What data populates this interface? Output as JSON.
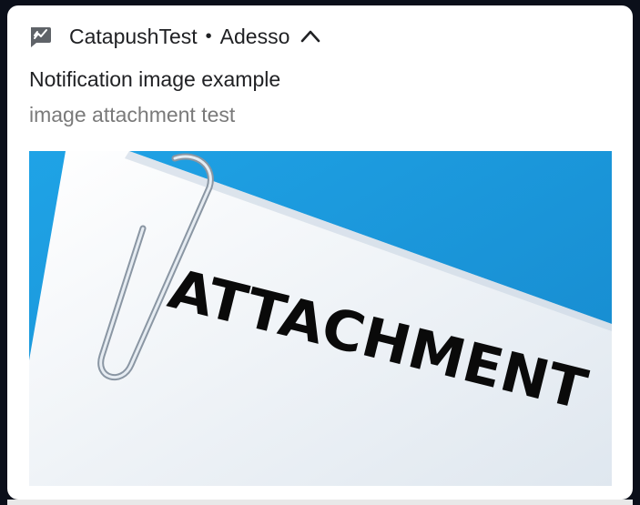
{
  "notification": {
    "app_icon": "chat-check-icon",
    "app_name": "CatapushTest",
    "separator": "•",
    "channel": "Adesso",
    "expand_icon": "chevron-up-icon",
    "title": "Notification image example",
    "body": "image attachment test",
    "image": {
      "text": "ATTACHMENT",
      "background_color": "#1b9be0",
      "paper_color": "#eef3f8",
      "text_color": "#0a0a0a"
    }
  }
}
